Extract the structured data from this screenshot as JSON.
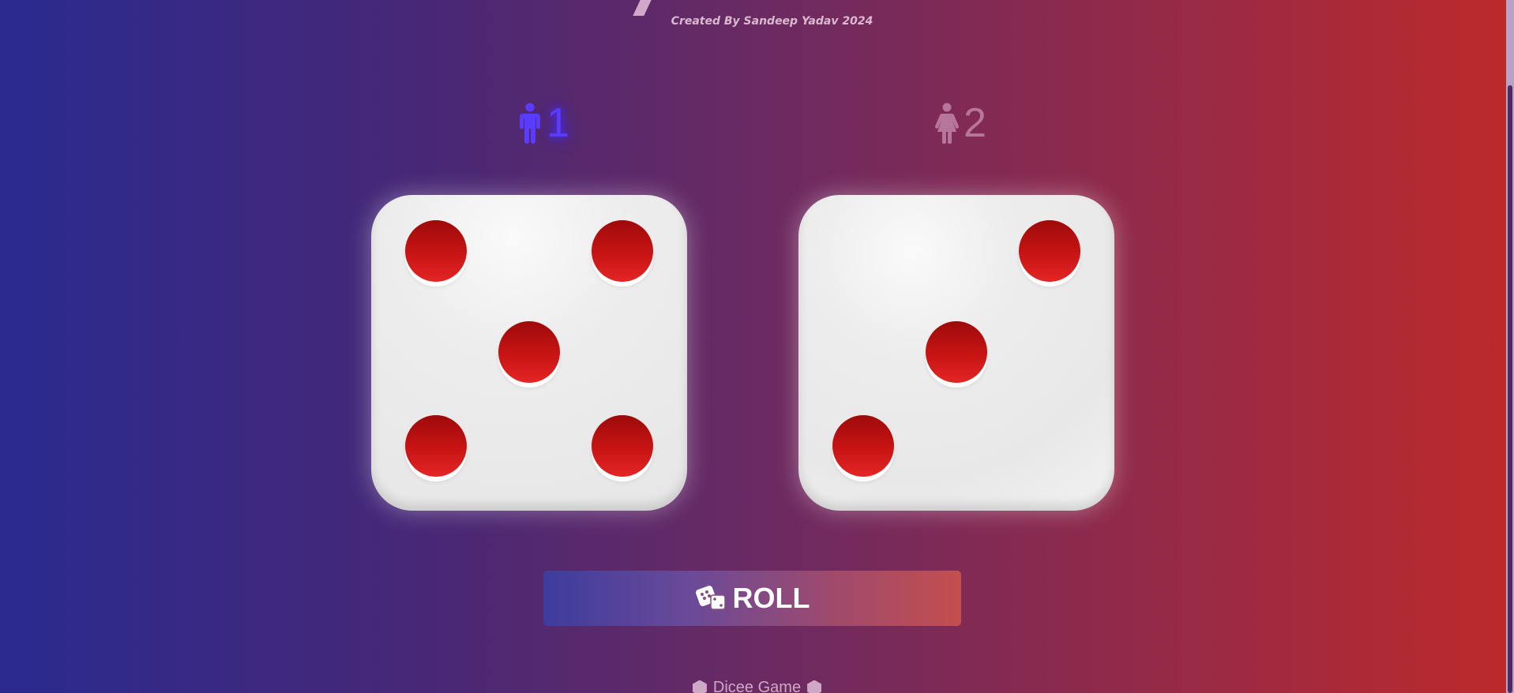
{
  "header": {
    "credit": "Created By Sandeep Yadav 2024"
  },
  "players": [
    {
      "number": "1",
      "icon": "male-person-icon",
      "active": true,
      "color": "#5a3cff"
    },
    {
      "number": "2",
      "icon": "female-person-icon",
      "active": false
    }
  ],
  "dice": [
    {
      "value": 5
    },
    {
      "value": 3
    }
  ],
  "roll_button": {
    "icon": "dice-icon",
    "label": "ROLL"
  },
  "footer": {
    "label": "Dicee Game",
    "icon": "hexagon-icon"
  },
  "colors": {
    "pip": "#c81414",
    "die_face": "#ececec",
    "background_left": "#2a2a8f",
    "background_right": "#bd2a2a"
  }
}
